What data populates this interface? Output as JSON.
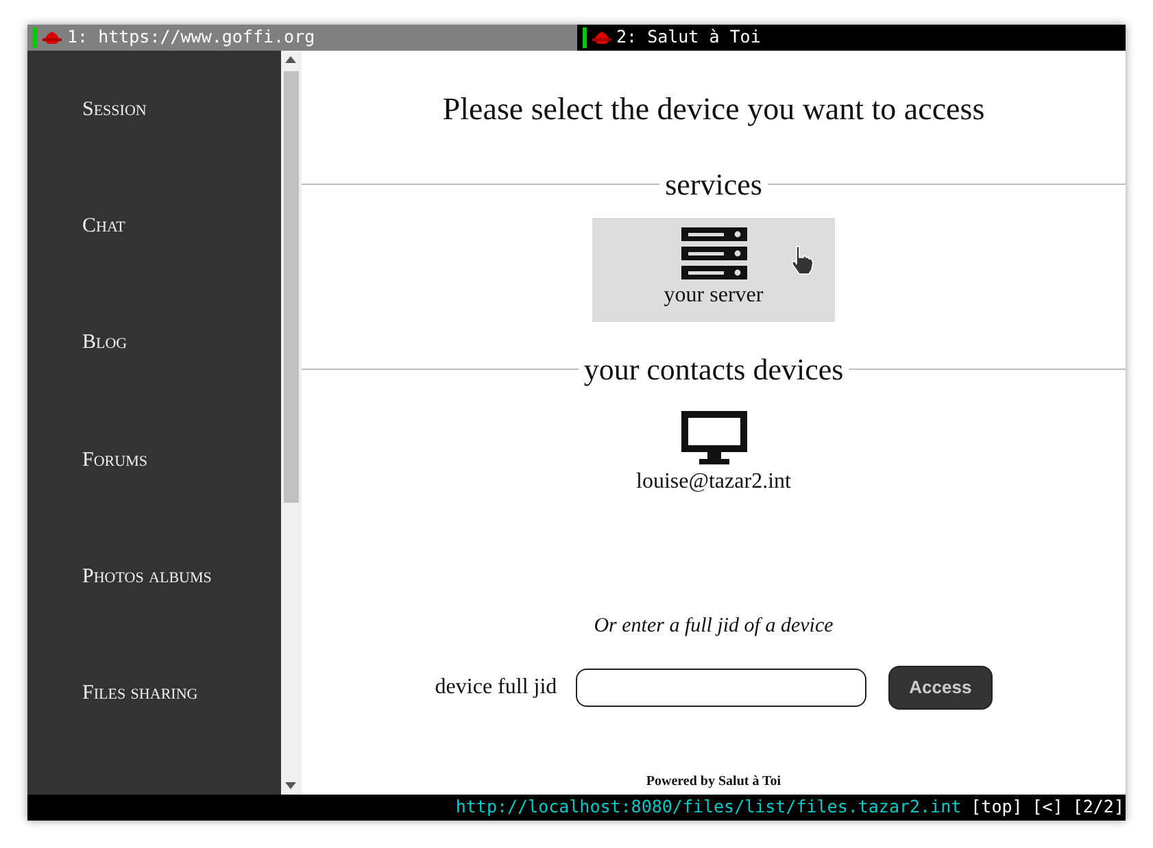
{
  "tabs": [
    {
      "label": "1: https://www.goffi.org",
      "selected": false
    },
    {
      "label": "2: Salut à Toi",
      "selected": true
    }
  ],
  "sidebar": {
    "items": [
      "Session",
      "Chat",
      "Blog",
      "Forums",
      "Photos albums",
      "Files sharing"
    ]
  },
  "main": {
    "title": "Please select the device you want to access",
    "sections": [
      {
        "heading": "services",
        "devices": [
          {
            "kind": "server",
            "label": "your server",
            "hovered": true
          }
        ]
      },
      {
        "heading": "your contacts devices",
        "devices": [
          {
            "kind": "computer",
            "label": "louise@tazar2.int",
            "hovered": false
          }
        ]
      }
    ],
    "jid_hint": "Or enter a full jid of a device",
    "jid_label": "device full jid",
    "access_button": "Access",
    "footer": "Powered by Salut à Toi"
  },
  "status_bar": {
    "url": "http://localhost:8080/files/list/files.tazar2.int",
    "position": "[top]",
    "history": "[<]",
    "tab_index": "[2/2]"
  }
}
